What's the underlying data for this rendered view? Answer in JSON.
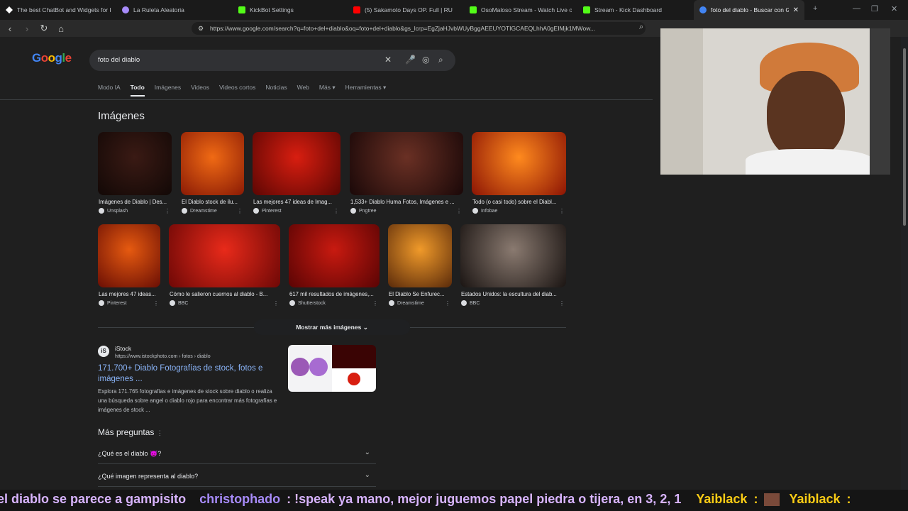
{
  "browser": {
    "tabs": [
      {
        "title": "The best ChatBot and Widgets for K",
        "favicon_color": "#ffffff"
      },
      {
        "title": "La Ruleta Aleatoria",
        "favicon_color": "#a78bfa"
      },
      {
        "title": "KickBot Settings",
        "favicon_color": "#53fc18"
      },
      {
        "title": "(5) Sakamoto Days OP. Full | RU",
        "favicon_color": "#ff0000"
      },
      {
        "title": "OsoMaloso Stream - Watch Live on",
        "favicon_color": "#53fc18"
      },
      {
        "title": "Stream - Kick Dashboard",
        "favicon_color": "#53fc18"
      },
      {
        "title": "foto del diablo - Buscar con Go",
        "favicon_color": "#4285f4"
      }
    ],
    "url": "https://www.google.com/search?q=foto+del+diablo&oq=foto+del+diablo&gs_lcrp=EgZjaHJvbWUyBggAEEUYOTIGCAEQLhhA0gEIMjk1MWow..."
  },
  "google": {
    "logo": "Google",
    "query": "foto del diablo",
    "filters": [
      "Modo IA",
      "Todo",
      "Imágenes",
      "Videos",
      "Videos cortos",
      "Noticias",
      "Web",
      "Más ▾",
      "Herramientas ▾"
    ],
    "active_filter": "Todo",
    "images_heading": "Imágenes",
    "image_rows": [
      [
        {
          "caption": "Imágenes de Diablo | Des...",
          "source": "Unsplash",
          "colors": [
            "#3a1a14",
            "#120806"
          ]
        },
        {
          "caption": "El Diablo stock de ilu...",
          "source": "Dreamstime",
          "colors": [
            "#f06a14",
            "#8a1a05"
          ]
        },
        {
          "caption": "Las mejores 47 ideas de Imag...",
          "source": "Pinterest",
          "colors": [
            "#d81e10",
            "#5c0603"
          ]
        },
        {
          "caption": "1,533+ Diablo Huma Fotos, Imágenes e ...",
          "source": "Pngtree",
          "colors": [
            "#6a3024",
            "#1a0808"
          ]
        },
        {
          "caption": "Todo (o casi todo) sobre el Diabl...",
          "source": "Infobae",
          "colors": [
            "#ff8a1e",
            "#8c1404"
          ]
        }
      ],
      [
        {
          "caption": "Las mejores 47 ideas...",
          "source": "Pinterest",
          "colors": [
            "#e65a10",
            "#6a0e04"
          ]
        },
        {
          "caption": "Cómo le salieron cuernos al diablo - B...",
          "source": "BBC",
          "colors": [
            "#e82a1a",
            "#6e0806"
          ]
        },
        {
          "caption": "617 mil resultados de imágenes,...",
          "source": "Shutterstock",
          "colors": [
            "#c81a10",
            "#5a0404"
          ]
        },
        {
          "caption": "El Diablo Se Enfurec...",
          "source": "Dreamstime",
          "colors": [
            "#f09a2a",
            "#5a2a0a"
          ]
        },
        {
          "caption": "Estados Unidos: la escultura del diab...",
          "source": "BBC",
          "colors": [
            "#8a7a70",
            "#1a1412"
          ]
        }
      ]
    ],
    "more_images": "Mostrar más imágenes",
    "result": {
      "site": "iStock",
      "logo_text": "iS",
      "url": "https://www.istockphoto.com › fotos › diablo",
      "title": "171.700+ Diablo Fotografías de stock, fotos e imágenes ...",
      "snippet": "Explora 171.765 fotografías e imágenes de stock sobre diablo o realiza una búsqueda sobre angel o diablo rojo para encontrar más fotografías e imágenes de stock ..."
    },
    "paa_heading": "Más preguntas",
    "questions": [
      "¿Qué es el diablo 👿?",
      "¿Qué imagen representa al diablo?"
    ]
  },
  "ticker": [
    {
      "text": "el diablo se parece a gampisito",
      "color": "#d8b4fe"
    },
    {
      "text": "christophado",
      "color": "#a78bfa"
    },
    {
      "text": ": !speak ya mano, mejor juguemos papel piedra o tijera, en 3, 2, 1",
      "color": "#d8b4fe"
    },
    {
      "text": "Yaiblack",
      "color": "#facc15"
    },
    {
      "text": ":",
      "color": "#facc15"
    },
    {
      "text": "Yaiblack",
      "color": "#facc15"
    },
    {
      "text": ":",
      "color": "#facc15"
    }
  ]
}
